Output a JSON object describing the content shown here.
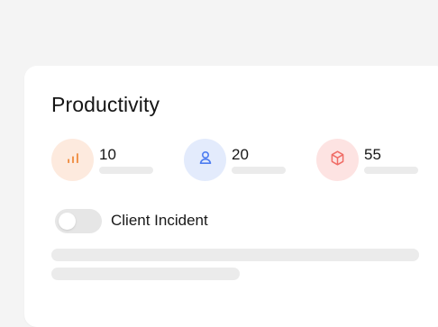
{
  "card": {
    "title": "Productivity",
    "stats": [
      {
        "value": "10",
        "icon": "chart-bars-icon",
        "bg_color": "#fdeade",
        "icon_color": "#ef8a3d"
      },
      {
        "value": "20",
        "icon": "user-icon",
        "bg_color": "#e3ebfc",
        "icon_color": "#4d7cf0"
      },
      {
        "value": "55",
        "icon": "cube-icon",
        "bg_color": "#fde3e2",
        "icon_color": "#f06c66"
      }
    ],
    "toggle": {
      "label": "Client Incident",
      "state": "off"
    }
  }
}
